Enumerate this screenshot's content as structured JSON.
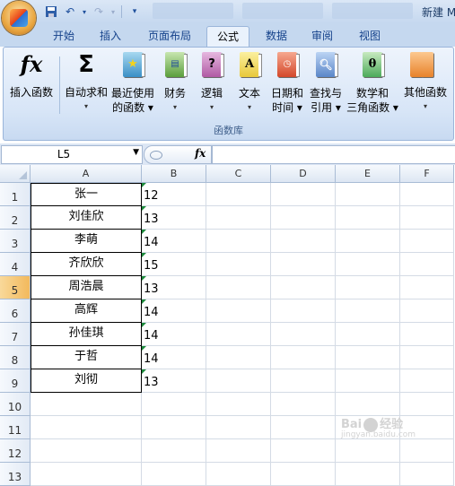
{
  "window": {
    "title": "新建 M"
  },
  "tabs": [
    "开始",
    "插入",
    "页面布局",
    "公式",
    "数据",
    "审阅",
    "视图"
  ],
  "active_tab": "公式",
  "ribbon": {
    "group_label": "函数库",
    "buttons": [
      {
        "label1": "插入函数",
        "label2": "",
        "icon": "fx-icon"
      },
      {
        "label1": "自动求和",
        "label2": "▾",
        "icon": "sigma-icon"
      },
      {
        "label1": "最近使用",
        "label2": "的函数 ▾",
        "icon": "recent-functions-icon"
      },
      {
        "label1": "财务",
        "label2": "▾",
        "icon": "financial-book-icon"
      },
      {
        "label1": "逻辑",
        "label2": "▾",
        "icon": "logical-book-icon"
      },
      {
        "label1": "文本",
        "label2": "▾",
        "icon": "text-book-icon"
      },
      {
        "label1": "日期和",
        "label2": "时间 ▾",
        "icon": "datetime-book-icon"
      },
      {
        "label1": "查找与",
        "label2": "引用 ▾",
        "icon": "lookup-book-icon"
      },
      {
        "label1": "数学和",
        "label2": "三角函数 ▾",
        "icon": "math-book-icon"
      },
      {
        "label1": "其他函数",
        "label2": "▾",
        "icon": "more-functions-icon"
      }
    ]
  },
  "formula_bar": {
    "name_box": "L5",
    "fx_label": "fx",
    "formula": ""
  },
  "columns": [
    "A",
    "B",
    "C",
    "D",
    "E",
    "F"
  ],
  "rows": [
    "1",
    "2",
    "3",
    "4",
    "5",
    "6",
    "7",
    "8",
    "9",
    "10",
    "11",
    "12",
    "13"
  ],
  "selected_row": "5",
  "data": [
    {
      "name": "张一",
      "value": "12"
    },
    {
      "name": "刘佳欣",
      "value": "13"
    },
    {
      "name": "李萌",
      "value": "14"
    },
    {
      "name": "齐欣欣",
      "value": "15"
    },
    {
      "name": "周浩晨",
      "value": "13"
    },
    {
      "name": "高辉",
      "value": "14"
    },
    {
      "name": "孙佳琪",
      "value": "14"
    },
    {
      "name": "于哲",
      "value": "14"
    },
    {
      "name": "刘彻",
      "value": "13"
    }
  ],
  "watermark": {
    "brand": "Bai",
    "brand2": "经验",
    "sub": "jingyan.baidu.com"
  },
  "colors": {
    "accent_ribbon": "#c5d8ef",
    "row_selected": "#f2b95c",
    "number_marker": "#1d8a3c"
  }
}
